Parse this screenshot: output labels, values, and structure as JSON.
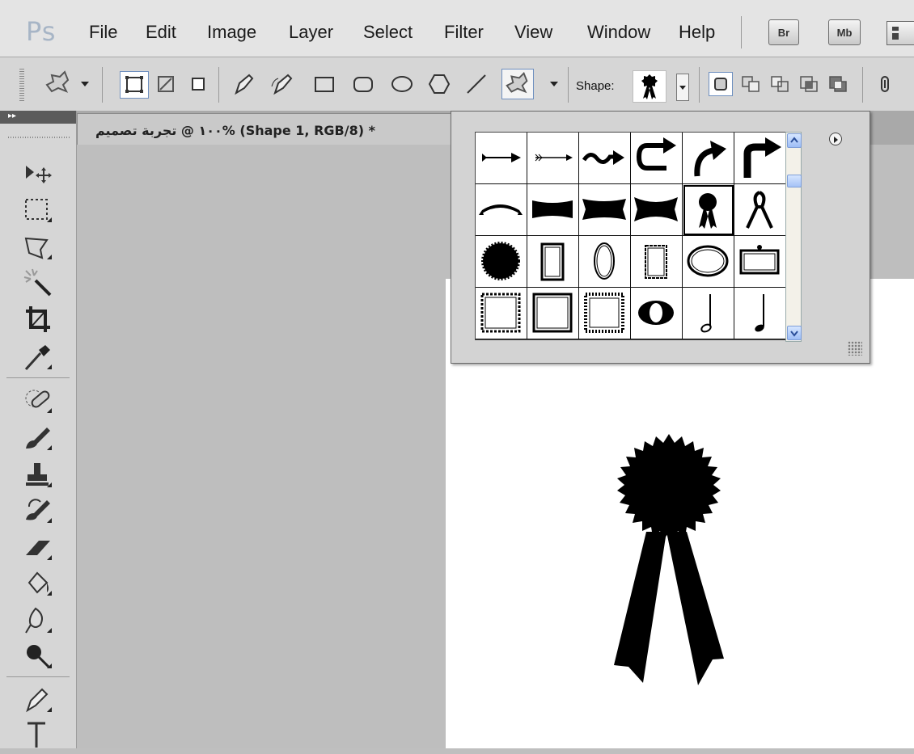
{
  "app": {
    "logo": "Ps"
  },
  "menu": [
    "File",
    "Edit",
    "Image",
    "Layer",
    "Select",
    "Filter",
    "View",
    "Window",
    "Help"
  ],
  "app_buttons": [
    "Br",
    "Mb"
  ],
  "options": {
    "shape_label": "Shape:",
    "tool_icons": [
      "custom-shape-tool-icon",
      "shape-layers-icon",
      "paths-icon",
      "fill-pixels-icon",
      "pen-icon",
      "freeform-pen-icon",
      "rectangle-icon",
      "rounded-rectangle-icon",
      "ellipse-icon",
      "polygon-icon",
      "line-icon",
      "custom-shape-icon",
      "new-layer-mode-icon",
      "add-mode-icon",
      "subtract-mode-icon",
      "intersect-mode-icon",
      "exclude-mode-icon",
      "link-icon"
    ]
  },
  "tools": [
    "move-tool-icon",
    "marquee-tool-icon",
    "lasso-tool-icon",
    "magic-wand-tool-icon",
    "crop-tool-icon",
    "eyedropper-tool-icon",
    "healing-brush-tool-icon",
    "brush-tool-icon",
    "clone-stamp-tool-icon",
    "history-brush-tool-icon",
    "eraser-tool-icon",
    "paint-bucket-tool-icon",
    "blur-tool-icon",
    "dodge-tool-icon",
    "pen-tool-icon",
    "type-tool-icon"
  ],
  "document": {
    "title": "١٠٠ @ تجربة تصميم% (Shape 1, RGB/8) *"
  },
  "picker": {
    "selected_shape": "ribbon-award",
    "shapes": [
      "arrow-1",
      "arrow-2",
      "arrow-3",
      "arrow-4",
      "arrow-5",
      "arrow-6",
      "banner-1",
      "banner-2",
      "banner-3",
      "banner-4",
      "ribbon-award",
      "ribbon-1",
      "seal",
      "frame-1",
      "frame-2",
      "frame-3",
      "frame-4",
      "frame-5",
      "frame-6",
      "frame-7",
      "frame-8",
      "frame-9",
      "half-note",
      "quarter-note"
    ]
  }
}
